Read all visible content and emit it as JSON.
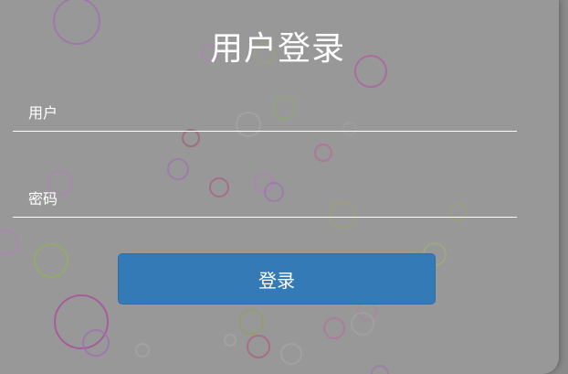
{
  "login": {
    "title": "用户登录",
    "username_placeholder": "用户",
    "password_placeholder": "密码",
    "submit_label": "登录"
  },
  "colors": {
    "background": "#989898",
    "button": "#337ab7",
    "text": "#ffffff",
    "bubble_palette": [
      "#a86fb8",
      "#b05a9a",
      "#8fae6a",
      "#c06a8a",
      "#9a9ab0"
    ]
  }
}
